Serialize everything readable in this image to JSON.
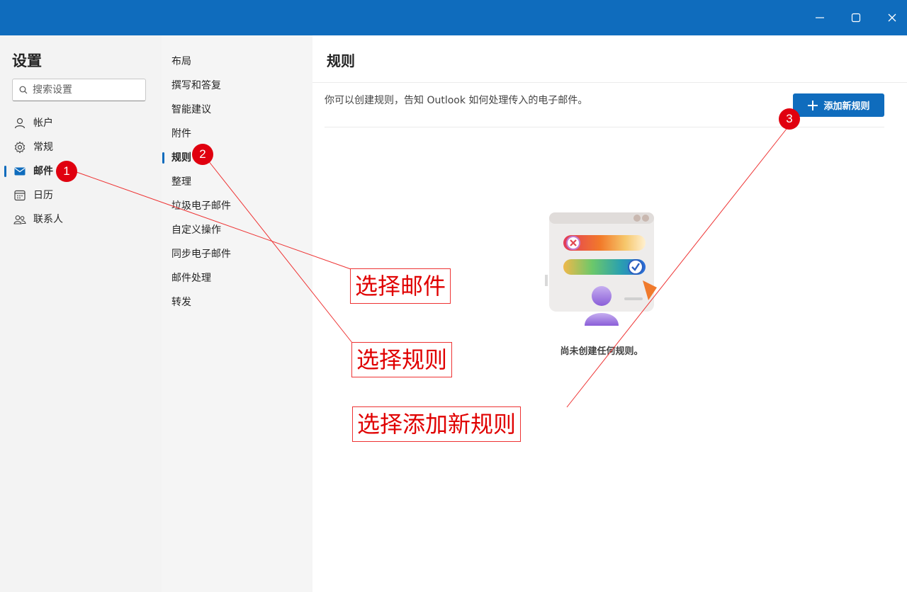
{
  "window": {
    "minimize_label": "Minimize",
    "maximize_label": "Maximize",
    "close_label": "Close"
  },
  "settings": {
    "title": "设置",
    "search_placeholder": "搜索设置",
    "categories": [
      {
        "label": "帐户",
        "icon": "person-icon"
      },
      {
        "label": "常规",
        "icon": "gear-icon"
      },
      {
        "label": "邮件",
        "icon": "mail-icon",
        "selected": true
      },
      {
        "label": "日历",
        "icon": "calendar-icon"
      },
      {
        "label": "联系人",
        "icon": "people-icon"
      }
    ]
  },
  "mail_sections": [
    {
      "label": "布局"
    },
    {
      "label": "撰写和答复"
    },
    {
      "label": "智能建议"
    },
    {
      "label": "附件"
    },
    {
      "label": "规则",
      "selected": true
    },
    {
      "label": "整理"
    },
    {
      "label": "垃圾电子邮件"
    },
    {
      "label": "自定义操作"
    },
    {
      "label": "同步电子邮件"
    },
    {
      "label": "邮件处理"
    },
    {
      "label": "转发"
    }
  ],
  "main": {
    "title": "规则",
    "description": "你可以创建规则，告知 Outlook 如何处理传入的电子邮件。",
    "add_button_label": "添加新规则",
    "empty_state_text": "尚未创建任何规则。"
  },
  "annotations": {
    "markers": [
      "1",
      "2",
      "3"
    ],
    "callouts": [
      "选择邮件",
      "选择规则",
      "选择添加新规则"
    ],
    "color": "#e00000"
  },
  "colors": {
    "accent": "#0f6cbd",
    "sidebar_bg": "#f3f3f3"
  }
}
